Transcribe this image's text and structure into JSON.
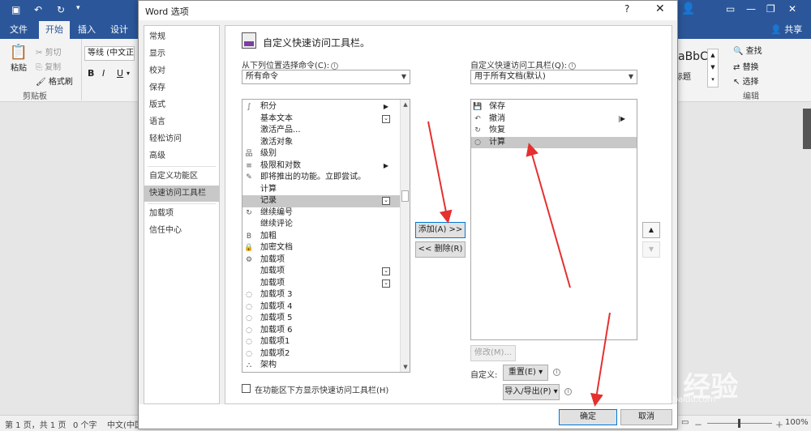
{
  "word": {
    "tabs": [
      "文件",
      "开始",
      "插入",
      "设计"
    ],
    "active_tab": "开始",
    "share": "共享",
    "clipboard": {
      "paste": "粘贴",
      "cut": "剪切",
      "copy": "复制",
      "format_painter": "格式刷",
      "group": "剪贴板"
    },
    "font_name": "等线 (中文正文",
    "style_preview": "aBbC",
    "style_label": "标题",
    "editing": {
      "find": "查找",
      "replace": "替换",
      "select": "选择",
      "group": "编辑"
    },
    "status": {
      "page": "第 1 页，共 1 页",
      "words": "0 个字",
      "lang": "中文(中国",
      "zoom": "100%"
    }
  },
  "dialog": {
    "title": "Word 选项",
    "help": "?",
    "close": "✕",
    "nav": [
      {
        "label": "常规"
      },
      {
        "label": "显示"
      },
      {
        "label": "校对"
      },
      {
        "label": "保存"
      },
      {
        "label": "版式"
      },
      {
        "label": "语言"
      },
      {
        "label": "轻松访问"
      },
      {
        "label": "高级"
      },
      {
        "label": "自定义功能区"
      },
      {
        "label": "快速访问工具栏"
      },
      {
        "label": "加载项"
      },
      {
        "label": "信任中心"
      }
    ],
    "selected_nav": "快速访问工具栏",
    "heading": "自定义快速访问工具栏。",
    "choose_label": "从下列位置选择命令(C):",
    "choose_value": "所有命令",
    "customize_label": "自定义快速访问工具栏(Q):",
    "customize_value": "用于所有文档(默认)",
    "commands": [
      {
        "icon": "∫",
        "label": "积分",
        "sub": "▶"
      },
      {
        "icon": "",
        "label": "基本文本",
        "sub": "box"
      },
      {
        "icon": "",
        "label": "激活产品..."
      },
      {
        "icon": "",
        "label": "激活对象"
      },
      {
        "icon": "品",
        "label": "级别"
      },
      {
        "icon": "≡",
        "label": "极限和对数",
        "sub": "▶"
      },
      {
        "icon": "✎",
        "label": "即将推出的功能。立即尝试。"
      },
      {
        "icon": "",
        "label": "计算"
      },
      {
        "icon": "",
        "label": "记录",
        "selected": true,
        "sub": "box"
      },
      {
        "icon": "↻",
        "label": "继续编号"
      },
      {
        "icon": "",
        "label": "继续评论"
      },
      {
        "icon": "B",
        "label": "加粗"
      },
      {
        "icon": "🔒",
        "label": "加密文档"
      },
      {
        "icon": "⚙",
        "label": "加载项"
      },
      {
        "icon": "",
        "label": "加载项",
        "sub": "box"
      },
      {
        "icon": "",
        "label": "加载项",
        "sub": "box"
      },
      {
        "icon": "◌",
        "label": "加载项 3"
      },
      {
        "icon": "◌",
        "label": "加载项 4"
      },
      {
        "icon": "◌",
        "label": "加载项 5"
      },
      {
        "icon": "◌",
        "label": "加载项 6"
      },
      {
        "icon": "◌",
        "label": "加载项1"
      },
      {
        "icon": "◌",
        "label": "加载项2"
      },
      {
        "icon": "⛬",
        "label": "架构"
      }
    ],
    "toolbar_items": [
      {
        "icon": "💾",
        "label": "保存"
      },
      {
        "icon": "↶",
        "label": "撤消",
        "sub": "|▶"
      },
      {
        "icon": "↻",
        "label": "恢复"
      },
      {
        "icon": "○",
        "label": "计算",
        "selected": true
      }
    ],
    "add_button": "添加(A) >>",
    "remove_button": "<< 删除(R)",
    "modify_button": "修改(M)...",
    "customize_text": "自定义:",
    "reset_button": "重置(E) ▾",
    "import_export_button": "导入/导出(P) ▾",
    "show_below_label": "在功能区下方显示快速访问工具栏(H)",
    "ok_button": "确定",
    "cancel_button": "取消"
  },
  "watermark": {
    "text": "Bai 经验",
    "url": "jingyan.baidu.com"
  }
}
